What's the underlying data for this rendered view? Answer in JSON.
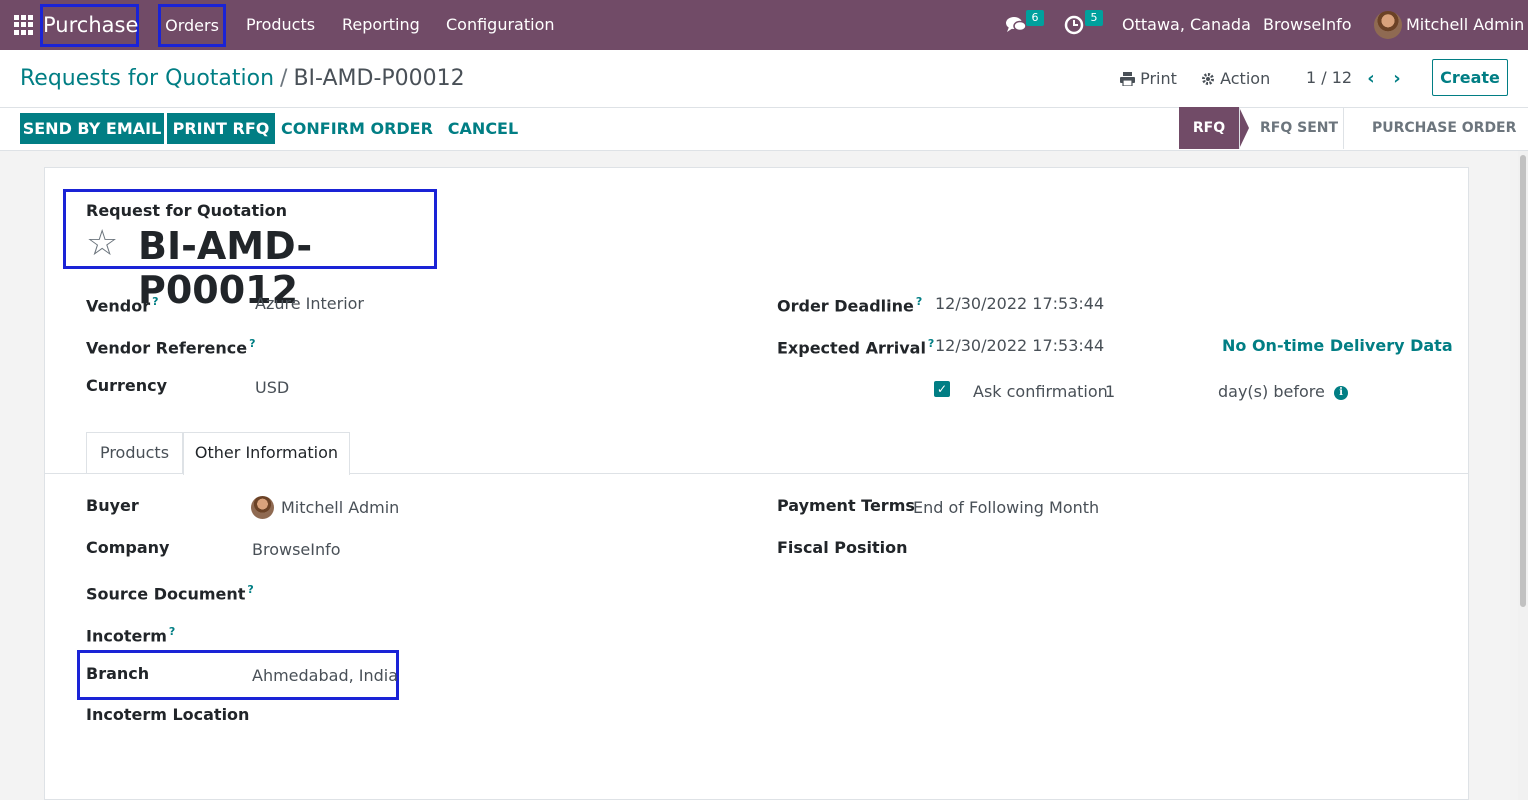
{
  "navbar": {
    "brand": "Purchase",
    "menu": [
      "Orders",
      "Products",
      "Reporting",
      "Configuration"
    ],
    "messages_count": "6",
    "activities_count": "5",
    "location": "Ottawa, Canada",
    "company": "BrowseInfo",
    "user": "Mitchell Admin"
  },
  "breadcrumb": {
    "parent": "Requests for Quotation",
    "separator": "/",
    "current": "BI-AMD-P00012"
  },
  "control": {
    "print": "Print",
    "action": "Action",
    "pager": "1 / 12",
    "create": "Create"
  },
  "actions": {
    "send_by_email": "SEND BY EMAIL",
    "print_rfq": "PRINT RFQ",
    "confirm_order": "CONFIRM ORDER",
    "cancel": "CANCEL"
  },
  "status": {
    "stages": [
      "RFQ",
      "RFQ SENT",
      "PURCHASE ORDER"
    ],
    "active": "RFQ"
  },
  "form": {
    "title_label": "Request for Quotation",
    "name": "BI-AMD-P00012",
    "vendor_label": "Vendor",
    "vendor": "Azure Interior",
    "vendor_ref_label": "Vendor Reference",
    "currency_label": "Currency",
    "currency": "USD",
    "order_deadline_label": "Order Deadline",
    "order_deadline": "12/30/2022 17:53:44",
    "expected_arrival_label": "Expected Arrival",
    "expected_arrival": "12/30/2022 17:53:44",
    "ontime_link": "No On-time Delivery Data",
    "ask_confirmation_label": "Ask confirmation",
    "ask_confirmation_days": "1",
    "days_before": "day(s) before",
    "help_mark": "?"
  },
  "tabs": [
    "Products",
    "Other Information"
  ],
  "other_info": {
    "buyer_label": "Buyer",
    "buyer": "Mitchell Admin",
    "company_label": "Company",
    "company": "BrowseInfo",
    "source_label": "Source Document",
    "incoterm_label": "Incoterm",
    "branch_label": "Branch",
    "branch": "Ahmedabad, India",
    "incoterm_location_label": "Incoterm Location",
    "payment_terms_label": "Payment Terms",
    "payment_terms": "End of Following Month",
    "fiscal_position_label": "Fiscal Position"
  }
}
